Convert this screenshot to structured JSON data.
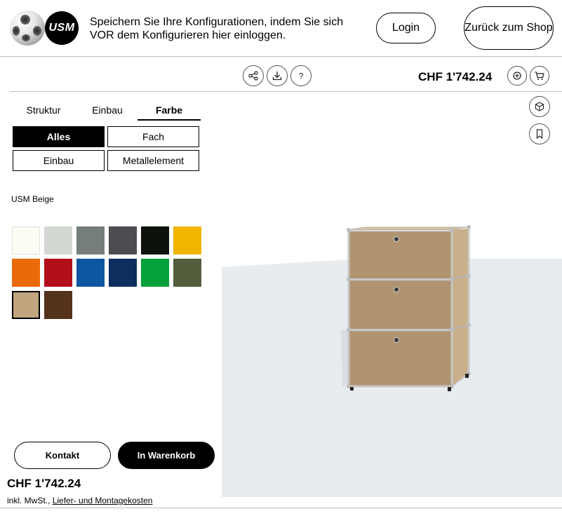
{
  "header": {
    "logo_text": "USM",
    "message": "Speichern Sie Ihre Konfigurationen, indem Sie sich VOR dem Konfigurieren hier einloggen.",
    "login_label": "Login",
    "back_to_shop_label": "Zurück zum Shop"
  },
  "toolbar": {
    "icons": [
      "share-icon",
      "download-icon",
      "help-icon",
      "zoom-in-icon",
      "cart-icon"
    ],
    "price": "CHF 1'742.24"
  },
  "canvas_tools": {
    "icons": [
      "undo-icon",
      "trash-icon",
      "zoom-reset-icon",
      "3d-view-icon",
      "bookmark-icon"
    ]
  },
  "tabs": [
    {
      "label": "Struktur",
      "active": false
    },
    {
      "label": "Einbau",
      "active": false
    },
    {
      "label": "Farbe",
      "active": true
    }
  ],
  "filters": [
    {
      "label": "Alles",
      "active": true
    },
    {
      "label": "Fach",
      "active": false
    },
    {
      "label": "Einbau",
      "active": false
    },
    {
      "label": "Metallelement",
      "active": false
    }
  ],
  "selected_color_name": "USM Beige",
  "swatches": [
    {
      "color": "#fcfcf4"
    },
    {
      "color": "#d4d8d2"
    },
    {
      "color": "#757d7d"
    },
    {
      "color": "#4c4d52"
    },
    {
      "color": "#0d120d"
    },
    {
      "color": "#f1b500"
    },
    {
      "color": "#ea6a0a"
    },
    {
      "color": "#b30f1b"
    },
    {
      "color": "#0e57a0"
    },
    {
      "color": "#0d2e5f"
    },
    {
      "color": "#04a03a"
    },
    {
      "color": "#535d3c"
    },
    {
      "color": "#c0a57f",
      "selected": true
    },
    {
      "color": "#55321c"
    }
  ],
  "actions": {
    "contact_label": "Kontakt",
    "cart_label": "In Warenkorb"
  },
  "footer": {
    "price": "CHF 1'742.24",
    "vat_prefix": "inkl. MwSt., ",
    "vat_link": "Liefer- und Montagekosten"
  },
  "colors": {
    "accent": "#000000",
    "product_beige": "#c0a57f",
    "floor": "#e9ecef"
  }
}
